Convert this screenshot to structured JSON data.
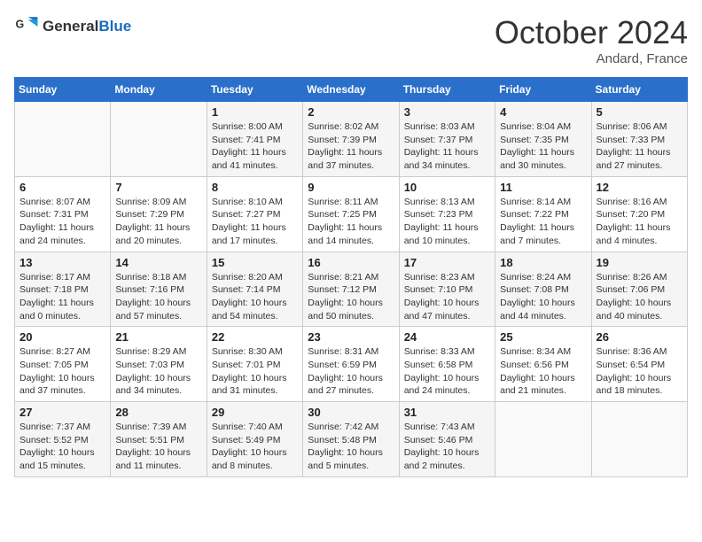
{
  "header": {
    "logo_general": "General",
    "logo_blue": "Blue",
    "month": "October 2024",
    "location": "Andard, France"
  },
  "weekdays": [
    "Sunday",
    "Monday",
    "Tuesday",
    "Wednesday",
    "Thursday",
    "Friday",
    "Saturday"
  ],
  "weeks": [
    [
      {
        "day": "",
        "info": ""
      },
      {
        "day": "",
        "info": ""
      },
      {
        "day": "1",
        "info": "Sunrise: 8:00 AM\nSunset: 7:41 PM\nDaylight: 11 hours and 41 minutes."
      },
      {
        "day": "2",
        "info": "Sunrise: 8:02 AM\nSunset: 7:39 PM\nDaylight: 11 hours and 37 minutes."
      },
      {
        "day": "3",
        "info": "Sunrise: 8:03 AM\nSunset: 7:37 PM\nDaylight: 11 hours and 34 minutes."
      },
      {
        "day": "4",
        "info": "Sunrise: 8:04 AM\nSunset: 7:35 PM\nDaylight: 11 hours and 30 minutes."
      },
      {
        "day": "5",
        "info": "Sunrise: 8:06 AM\nSunset: 7:33 PM\nDaylight: 11 hours and 27 minutes."
      }
    ],
    [
      {
        "day": "6",
        "info": "Sunrise: 8:07 AM\nSunset: 7:31 PM\nDaylight: 11 hours and 24 minutes."
      },
      {
        "day": "7",
        "info": "Sunrise: 8:09 AM\nSunset: 7:29 PM\nDaylight: 11 hours and 20 minutes."
      },
      {
        "day": "8",
        "info": "Sunrise: 8:10 AM\nSunset: 7:27 PM\nDaylight: 11 hours and 17 minutes."
      },
      {
        "day": "9",
        "info": "Sunrise: 8:11 AM\nSunset: 7:25 PM\nDaylight: 11 hours and 14 minutes."
      },
      {
        "day": "10",
        "info": "Sunrise: 8:13 AM\nSunset: 7:23 PM\nDaylight: 11 hours and 10 minutes."
      },
      {
        "day": "11",
        "info": "Sunrise: 8:14 AM\nSunset: 7:22 PM\nDaylight: 11 hours and 7 minutes."
      },
      {
        "day": "12",
        "info": "Sunrise: 8:16 AM\nSunset: 7:20 PM\nDaylight: 11 hours and 4 minutes."
      }
    ],
    [
      {
        "day": "13",
        "info": "Sunrise: 8:17 AM\nSunset: 7:18 PM\nDaylight: 11 hours and 0 minutes."
      },
      {
        "day": "14",
        "info": "Sunrise: 8:18 AM\nSunset: 7:16 PM\nDaylight: 10 hours and 57 minutes."
      },
      {
        "day": "15",
        "info": "Sunrise: 8:20 AM\nSunset: 7:14 PM\nDaylight: 10 hours and 54 minutes."
      },
      {
        "day": "16",
        "info": "Sunrise: 8:21 AM\nSunset: 7:12 PM\nDaylight: 10 hours and 50 minutes."
      },
      {
        "day": "17",
        "info": "Sunrise: 8:23 AM\nSunset: 7:10 PM\nDaylight: 10 hours and 47 minutes."
      },
      {
        "day": "18",
        "info": "Sunrise: 8:24 AM\nSunset: 7:08 PM\nDaylight: 10 hours and 44 minutes."
      },
      {
        "day": "19",
        "info": "Sunrise: 8:26 AM\nSunset: 7:06 PM\nDaylight: 10 hours and 40 minutes."
      }
    ],
    [
      {
        "day": "20",
        "info": "Sunrise: 8:27 AM\nSunset: 7:05 PM\nDaylight: 10 hours and 37 minutes."
      },
      {
        "day": "21",
        "info": "Sunrise: 8:29 AM\nSunset: 7:03 PM\nDaylight: 10 hours and 34 minutes."
      },
      {
        "day": "22",
        "info": "Sunrise: 8:30 AM\nSunset: 7:01 PM\nDaylight: 10 hours and 31 minutes."
      },
      {
        "day": "23",
        "info": "Sunrise: 8:31 AM\nSunset: 6:59 PM\nDaylight: 10 hours and 27 minutes."
      },
      {
        "day": "24",
        "info": "Sunrise: 8:33 AM\nSunset: 6:58 PM\nDaylight: 10 hours and 24 minutes."
      },
      {
        "day": "25",
        "info": "Sunrise: 8:34 AM\nSunset: 6:56 PM\nDaylight: 10 hours and 21 minutes."
      },
      {
        "day": "26",
        "info": "Sunrise: 8:36 AM\nSunset: 6:54 PM\nDaylight: 10 hours and 18 minutes."
      }
    ],
    [
      {
        "day": "27",
        "info": "Sunrise: 7:37 AM\nSunset: 5:52 PM\nDaylight: 10 hours and 15 minutes."
      },
      {
        "day": "28",
        "info": "Sunrise: 7:39 AM\nSunset: 5:51 PM\nDaylight: 10 hours and 11 minutes."
      },
      {
        "day": "29",
        "info": "Sunrise: 7:40 AM\nSunset: 5:49 PM\nDaylight: 10 hours and 8 minutes."
      },
      {
        "day": "30",
        "info": "Sunrise: 7:42 AM\nSunset: 5:48 PM\nDaylight: 10 hours and 5 minutes."
      },
      {
        "day": "31",
        "info": "Sunrise: 7:43 AM\nSunset: 5:46 PM\nDaylight: 10 hours and 2 minutes."
      },
      {
        "day": "",
        "info": ""
      },
      {
        "day": "",
        "info": ""
      }
    ]
  ]
}
